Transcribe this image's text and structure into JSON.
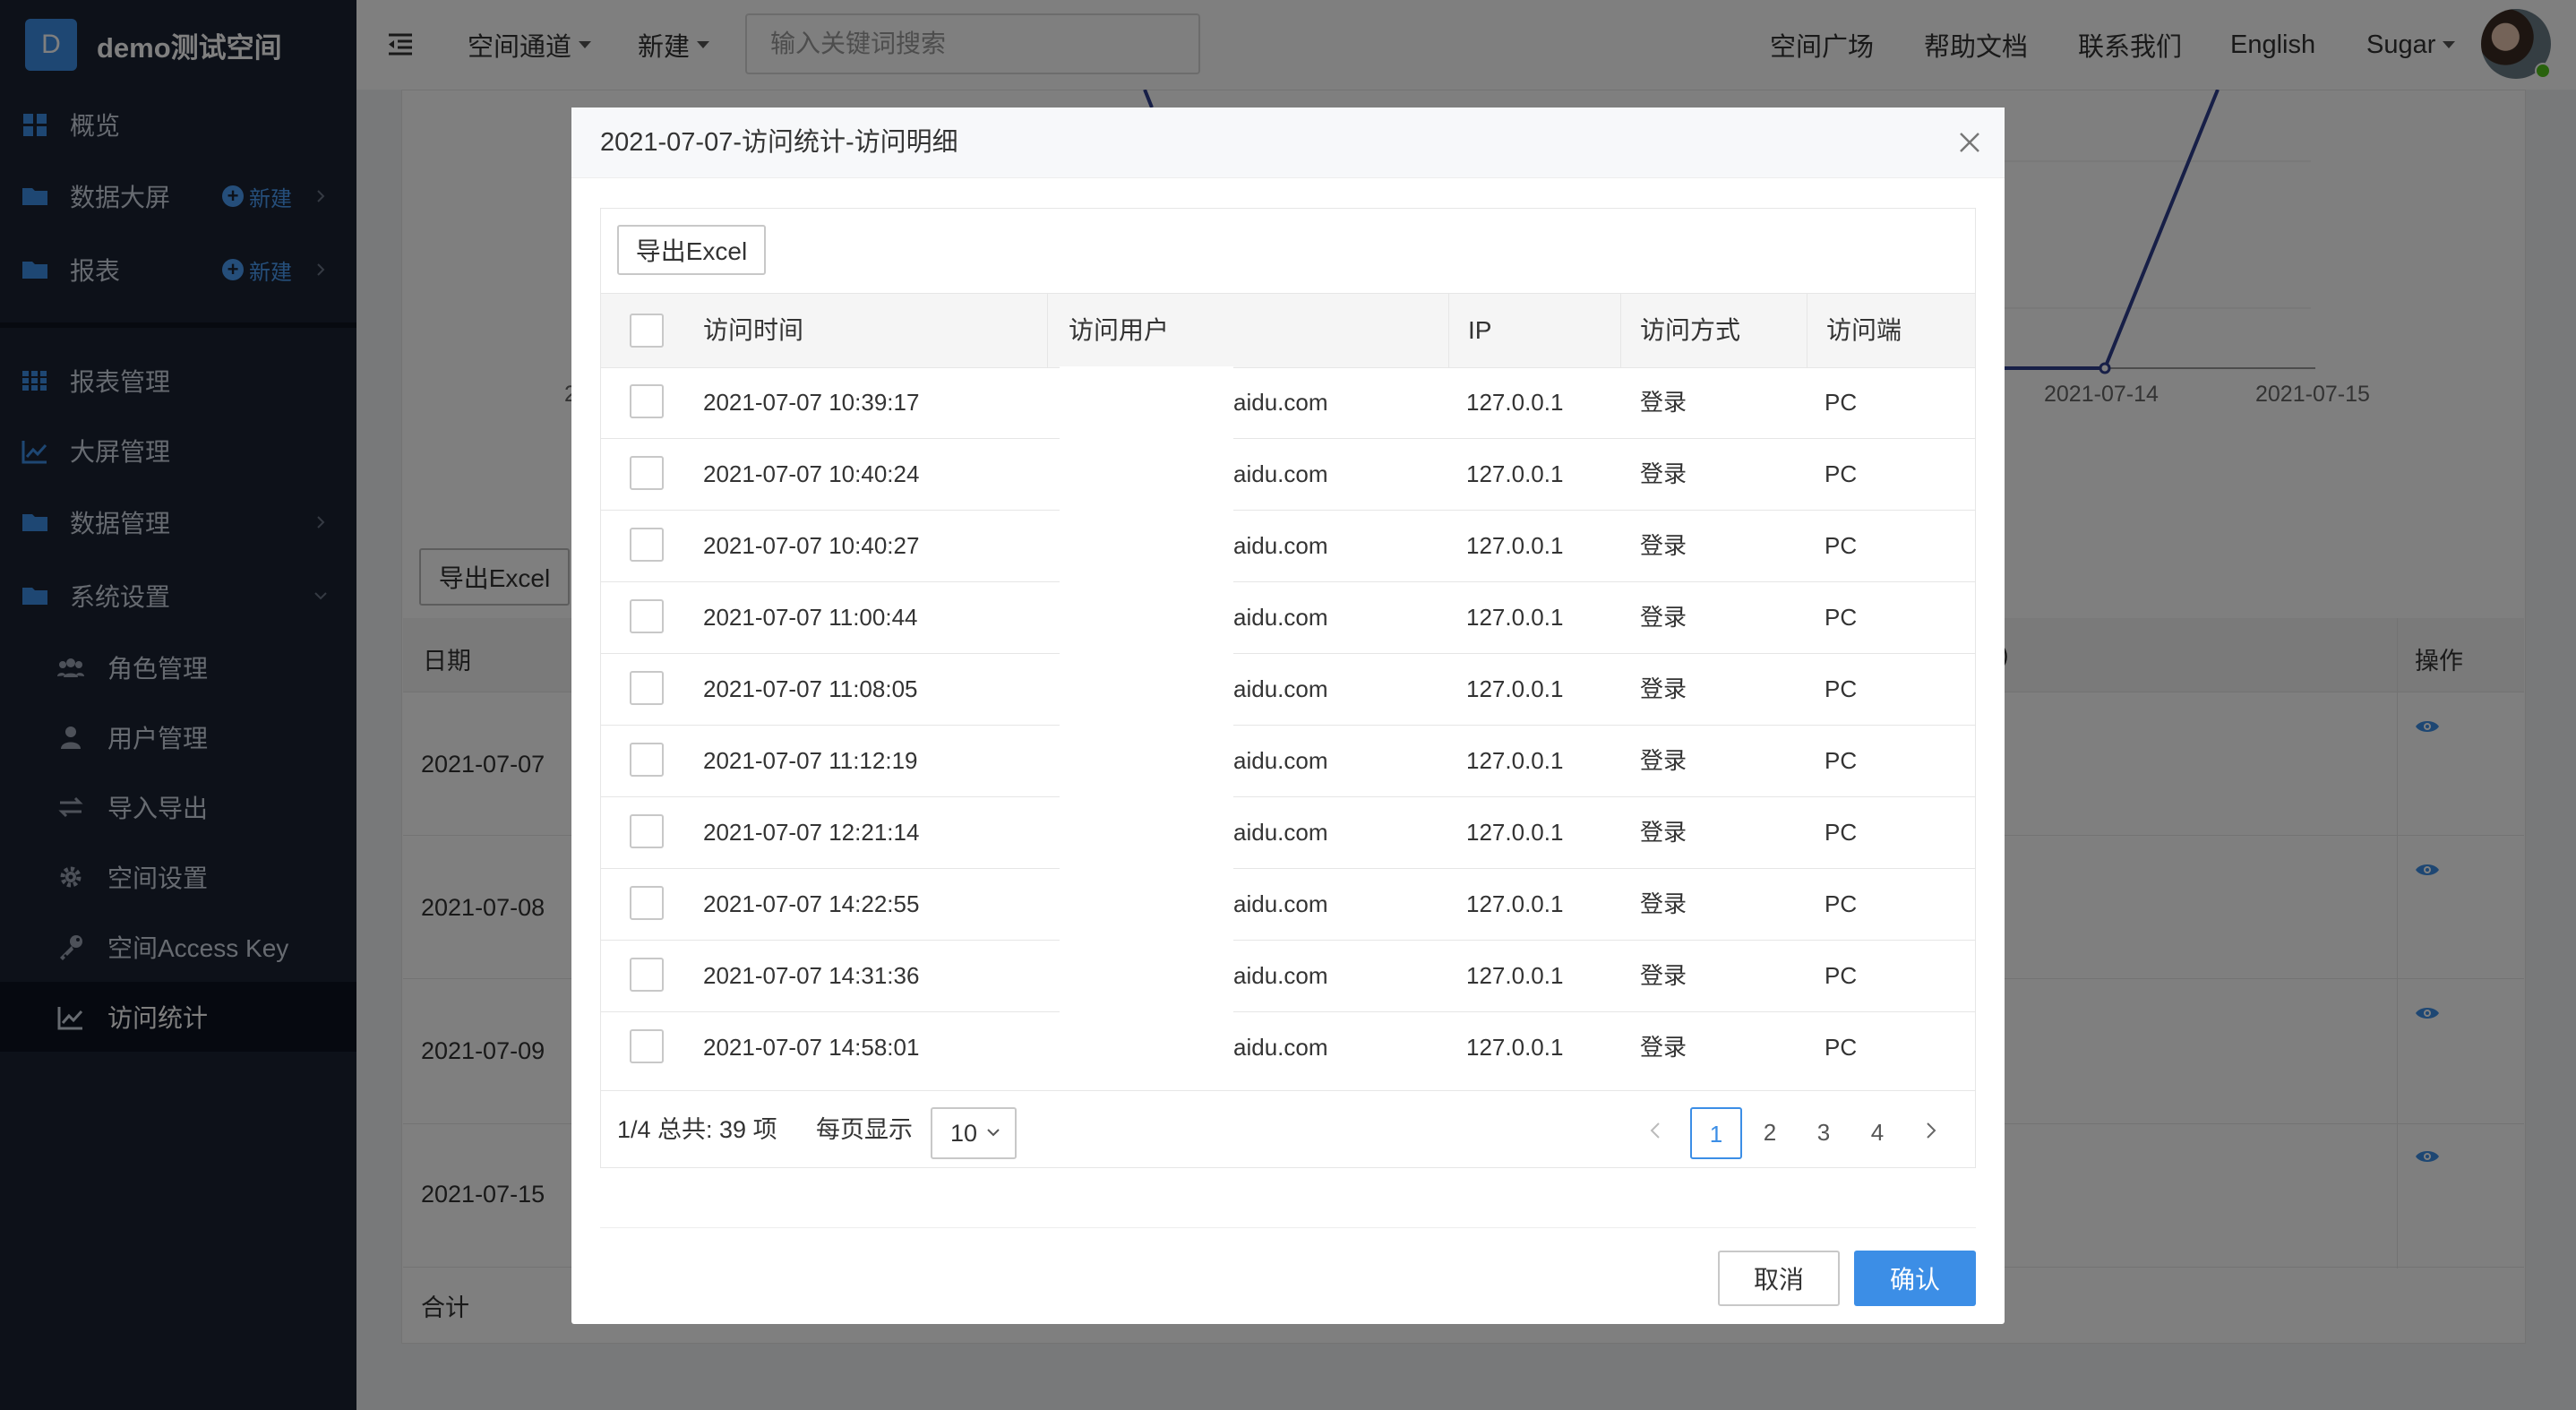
{
  "sidebar": {
    "logo_letter": "D",
    "space_name": "demo测试空间",
    "new_label": "新建",
    "items": [
      {
        "label": "概览"
      },
      {
        "label": "数据大屏"
      },
      {
        "label": "报表"
      },
      {
        "label": "报表管理"
      },
      {
        "label": "大屏管理"
      },
      {
        "label": "数据管理"
      },
      {
        "label": "系统设置"
      },
      {
        "label": "角色管理"
      },
      {
        "label": "用户管理"
      },
      {
        "label": "导入导出"
      },
      {
        "label": "空间设置"
      },
      {
        "label": "空间Access Key"
      },
      {
        "label": "访问统计"
      }
    ]
  },
  "header": {
    "space_channel": "空间通道",
    "new": "新建",
    "search_placeholder": "输入关键词搜索",
    "links": [
      "空间广场",
      "帮助文档",
      "联系我们",
      "English"
    ],
    "user": "Sugar"
  },
  "background": {
    "export_label": "导出Excel",
    "col_date": "日期",
    "col_partial": "/)",
    "col_action": "操作",
    "dates": [
      "2021-07-07",
      "2021-07-08",
      "2021-07-09",
      "2021-07-15"
    ],
    "total_label": "合计",
    "chart_ticks": [
      "2021-07-14",
      "2021-07-15"
    ],
    "chart_partial_tick": "2"
  },
  "modal": {
    "title": "2021-07-07-访问统计-访问明细",
    "export_label": "导出Excel",
    "columns": [
      "访问时间",
      "访问用户",
      "IP",
      "访问方式",
      "访问端"
    ],
    "rows": [
      {
        "time": "2021-07-07 10:39:17",
        "user": "aidu.com",
        "ip": "127.0.0.1",
        "method": "登录",
        "client": "PC"
      },
      {
        "time": "2021-07-07 10:40:24",
        "user": "aidu.com",
        "ip": "127.0.0.1",
        "method": "登录",
        "client": "PC"
      },
      {
        "time": "2021-07-07 10:40:27",
        "user": "aidu.com",
        "ip": "127.0.0.1",
        "method": "登录",
        "client": "PC"
      },
      {
        "time": "2021-07-07 11:00:44",
        "user": "aidu.com",
        "ip": "127.0.0.1",
        "method": "登录",
        "client": "PC"
      },
      {
        "time": "2021-07-07 11:08:05",
        "user": "aidu.com",
        "ip": "127.0.0.1",
        "method": "登录",
        "client": "PC"
      },
      {
        "time": "2021-07-07 11:12:19",
        "user": "aidu.com",
        "ip": "127.0.0.1",
        "method": "登录",
        "client": "PC"
      },
      {
        "time": "2021-07-07 12:21:14",
        "user": "aidu.com",
        "ip": "127.0.0.1",
        "method": "登录",
        "client": "PC"
      },
      {
        "time": "2021-07-07 14:22:55",
        "user": "aidu.com",
        "ip": "127.0.0.1",
        "method": "登录",
        "client": "PC"
      },
      {
        "time": "2021-07-07 14:31:36",
        "user": "aidu.com",
        "ip": "127.0.0.1",
        "method": "登录",
        "client": "PC"
      },
      {
        "time": "2021-07-07 14:58:01",
        "user": "aidu.com",
        "ip": "127.0.0.1",
        "method": "登录",
        "client": "PC"
      }
    ],
    "pagination": {
      "page_info": "1/4 总共: 39 项",
      "per_page_label": "每页显示",
      "per_page_value": "10",
      "pages": [
        "1",
        "2",
        "3",
        "4"
      ],
      "current": "1"
    },
    "cancel_label": "取消",
    "confirm_label": "确认"
  },
  "colors": {
    "sidebar_bg": "#1a2233",
    "accent": "#3c8ee6",
    "chart_line": "#2f3e8f"
  }
}
